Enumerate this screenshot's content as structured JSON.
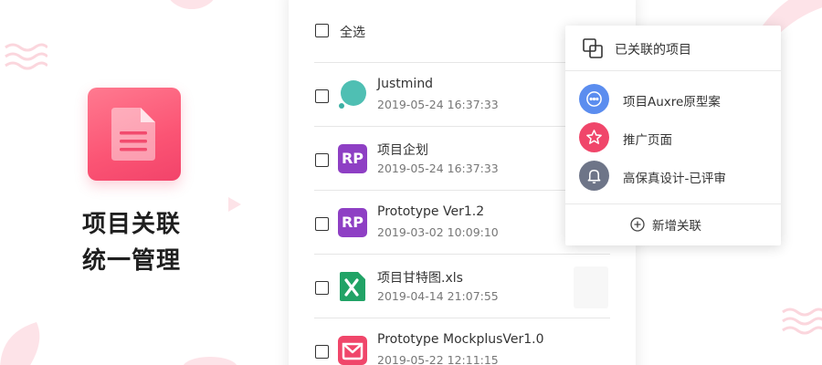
{
  "promo": {
    "line1": "项目关联",
    "line2": "统一管理",
    "icon": "document-icon",
    "accent": "#fb5474"
  },
  "list": {
    "select_all_label": "全选",
    "files": [
      {
        "name": "Justmind",
        "date": "2019-05-24 16:37:33",
        "icon": "justmind-logo-icon"
      },
      {
        "name": "项目企划",
        "date": "2019-05-24 16:37:33",
        "icon": "rp-file-icon",
        "badge": "RP"
      },
      {
        "name": "Prototype Ver1.2",
        "date": "2019-03-02 10:09:10",
        "icon": "rp-file-icon",
        "badge": "RP"
      },
      {
        "name": "项目甘特图.xls",
        "date": "2019-04-14 21:07:55",
        "icon": "excel-file-icon"
      },
      {
        "name": "Prototype MockplusVer1.0",
        "date": "2019-05-22 12:11:15",
        "icon": "mockplus-file-icon"
      }
    ]
  },
  "popover": {
    "title": "已关联的项目",
    "items": [
      {
        "label": "项目Auxre原型案",
        "icon": "chat-bubble-icon",
        "color": "#5b8def"
      },
      {
        "label": "推广页面",
        "icon": "star-icon",
        "color": "#f0466a"
      },
      {
        "label": "高保真设计-已评审",
        "icon": "bell-icon",
        "color": "#6e7588"
      }
    ],
    "add_label": "新增关联"
  }
}
